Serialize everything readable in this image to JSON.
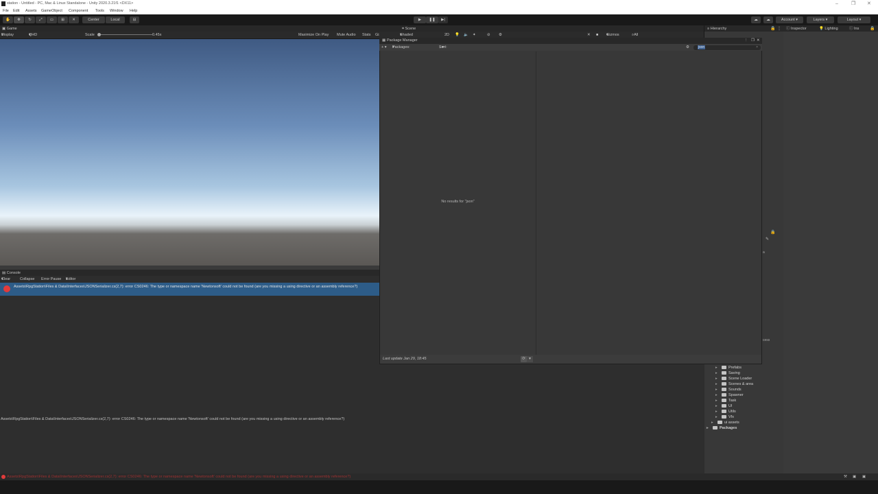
{
  "titlebar": {
    "title": "station - Untitled - PC, Mac & Linux Standalone - Unity 2020.3.21f1 <DX11>"
  },
  "menu": [
    "File",
    "Edit",
    "Assets",
    "GameObject",
    "Component",
    "Tools",
    "Window",
    "Help"
  ],
  "toolbar": {
    "pivot": "Center",
    "space": "Local",
    "account": "Account",
    "layers": "Layers",
    "layout": "Layout"
  },
  "tabs": {
    "game": "Game",
    "scene": "Scene",
    "hierarchy": "Hierarchy",
    "inspector": "Inspector",
    "lighting": "Lighting",
    "ins": "Ins",
    "console": "Console"
  },
  "game_toolbar": {
    "display": "Display 1",
    "resolution": "QHD (2560x1440)",
    "scale_label": "Scale",
    "scale_value": "0.45x",
    "maximize": "Maximize On Play",
    "mute": "Mute Audio",
    "stats": "Stats",
    "gizmos": "Gizmos"
  },
  "scene_toolbar": {
    "shading": "Shaded",
    "mode": "2D",
    "gizmos": "Gizmos",
    "search": "All"
  },
  "console_toolbar": {
    "clear": "Clear",
    "collapse": "Collapse",
    "error_pause": "Error Pause",
    "editor": "Editor"
  },
  "console": {
    "error_line": "Assets\\RpgStation\\Files & Data\\Interfaces\\JSONSerializer.cs(2,7): error CS0246: The type or namespace name 'Newtonsoft' could not be found (are you missing a using directive or an assembly reference?)",
    "detail": "Assets\\RpgStation\\Files & Data\\Interfaces\\JSONSerializer.cs(2,7): error CS0246: The type or namespace name 'Newtonsoft' could not be found (are you missing a using directive or an assembly reference?)"
  },
  "package_manager": {
    "title": "Package Manager",
    "packages_filter": "Packages: In Project",
    "sort": "Sort: Name",
    "search_value": "json",
    "empty": "No results for \"json\"",
    "last_update": "Last update Jan 29, 18:45"
  },
  "project_folders": [
    "Prefabs",
    "Saving",
    "Scene Loader",
    "Scenes & area",
    "Sounds",
    "Spawner",
    "Task",
    "UI",
    "Utils",
    "Vfx",
    "ui assets"
  ],
  "packages_label": "Packages",
  "inspector_fragments": {
    "a": "a",
    "cess": "cess"
  },
  "status": {
    "text": "Assets\\RpgStation\\Files & Data\\Interfaces\\JSONSerializer.cs(2,7): error CS0246: The type or namespace name 'Newtonsoft' could not be found (are you missing a using directive or an assembly reference?)"
  }
}
